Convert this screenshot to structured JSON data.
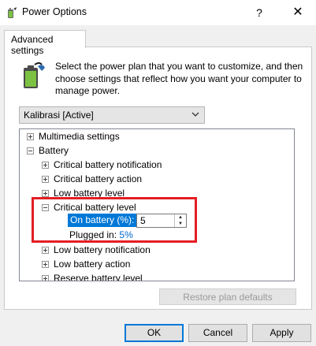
{
  "window": {
    "title": "Power Options",
    "help_label": "?",
    "close_label": "✕"
  },
  "tab": {
    "label": "Advanced settings"
  },
  "description": "Select the power plan that you want to customize, and then choose settings that reflect how you want your computer to manage power.",
  "plan_select": {
    "value": "Kalibrasi [Active]"
  },
  "tree": {
    "items": [
      {
        "label": "Multimedia settings",
        "state": "collapsed"
      },
      {
        "label": "Battery",
        "state": "expanded"
      },
      {
        "label": "Critical battery notification",
        "state": "collapsed"
      },
      {
        "label": "Critical battery action",
        "state": "collapsed"
      },
      {
        "label": "Low battery level",
        "state": "collapsed"
      },
      {
        "label": "Critical battery level",
        "state": "expanded"
      },
      {
        "label": "Low battery notification",
        "state": "collapsed"
      },
      {
        "label": "Low battery action",
        "state": "collapsed"
      },
      {
        "label": "Reserve battery level",
        "state": "collapsed"
      }
    ],
    "on_battery": {
      "label": "On battery (%):",
      "value": "5"
    },
    "plugged_in": {
      "label": "Plugged in:",
      "value": "5%"
    }
  },
  "buttons": {
    "restore": "Restore plan defaults",
    "ok": "OK",
    "cancel": "Cancel",
    "apply": "Apply"
  },
  "colors": {
    "selection": "#0078d7",
    "highlight_border": "#e31e24",
    "link_value": "#0066cc"
  },
  "icons": {
    "title": "power-options-icon",
    "battery": "battery-plug-icon"
  }
}
